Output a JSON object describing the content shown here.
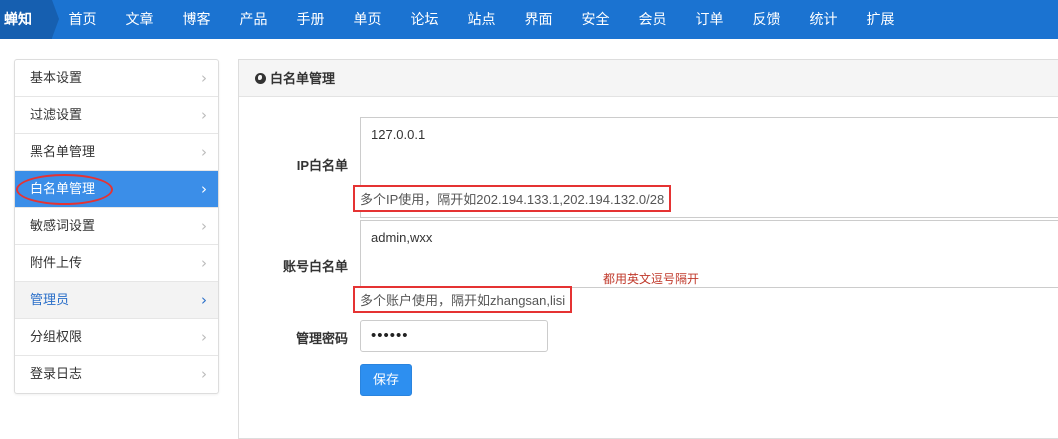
{
  "brand": "蝉知",
  "nav": [
    "首页",
    "文章",
    "博客",
    "产品",
    "手册",
    "单页",
    "论坛",
    "站点",
    "界面",
    "安全",
    "会员",
    "订单",
    "反馈",
    "统计",
    "扩展"
  ],
  "sidebar": {
    "items": [
      {
        "label": "基本设置",
        "state": "normal"
      },
      {
        "label": "过滤设置",
        "state": "normal"
      },
      {
        "label": "黑名单管理",
        "state": "normal"
      },
      {
        "label": "白名单管理",
        "state": "active"
      },
      {
        "label": "敏感词设置",
        "state": "normal"
      },
      {
        "label": "附件上传",
        "state": "normal"
      },
      {
        "label": "管理员",
        "state": "hover"
      },
      {
        "label": "分组权限",
        "state": "normal"
      },
      {
        "label": "登录日志",
        "state": "normal"
      }
    ],
    "chevron": "›"
  },
  "panel": {
    "title": "白名单管理"
  },
  "form": {
    "ip_label": "IP白名单",
    "ip_value": "127.0.0.1",
    "ip_hint": "多个IP使用，隔开如202.194.133.1,202.194.132.0/28",
    "account_label": "账号白名单",
    "account_value": "admin,wxx",
    "account_hint": "多个账户使用，隔开如zhangsan,lisi",
    "account_note": "都用英文逗号隔开",
    "password_label": "管理密码",
    "password_value": "••••••",
    "save_label": "保存"
  },
  "colors": {
    "nav_bg": "#1b73d1",
    "active_bg": "#3b8ee8",
    "annotation_red": "#e53333",
    "button_bg": "#2d8ff0"
  }
}
